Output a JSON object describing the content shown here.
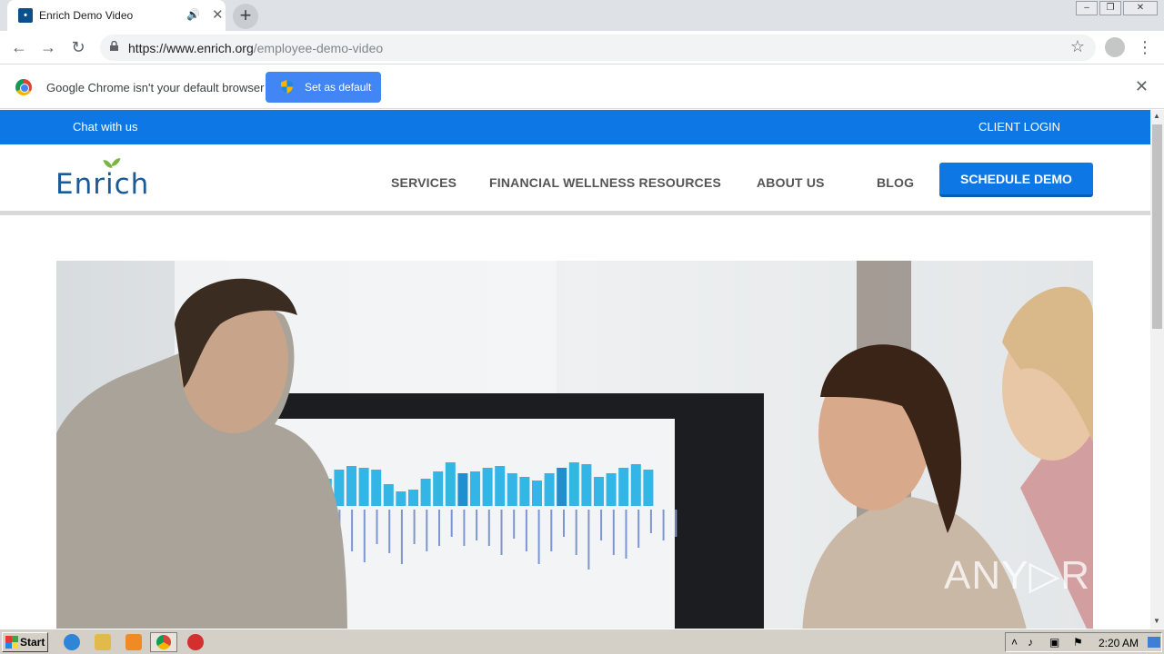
{
  "browser": {
    "tab_title": "Enrich Demo Video",
    "url_host": "https://www.enrich.org",
    "url_path": "/employee-demo-video",
    "new_tab": "+",
    "tab_close": "✕",
    "audio_icon": "🔊"
  },
  "infobar": {
    "message": "Google Chrome isn't your default browser",
    "set_default": "Set as default",
    "close": "✕"
  },
  "site": {
    "topbar": {
      "chat": "Chat with us",
      "login": "CLIENT LOGIN"
    },
    "logo": "Enrich",
    "nav": [
      {
        "label": "SERVICES"
      },
      {
        "label": "FINANCIAL WELLNESS RESOURCES"
      },
      {
        "label": "ABOUT US"
      },
      {
        "label": "BLOG"
      }
    ],
    "cta": "SCHEDULE DEMO"
  },
  "taskbar": {
    "start": "Start",
    "clock": "2:20 AM"
  },
  "watermark": "ANY▷RUN",
  "colors": {
    "brand_blue": "#0d78e5",
    "logo_blue": "#1a5a96",
    "leaf_green": "#7cb342"
  }
}
